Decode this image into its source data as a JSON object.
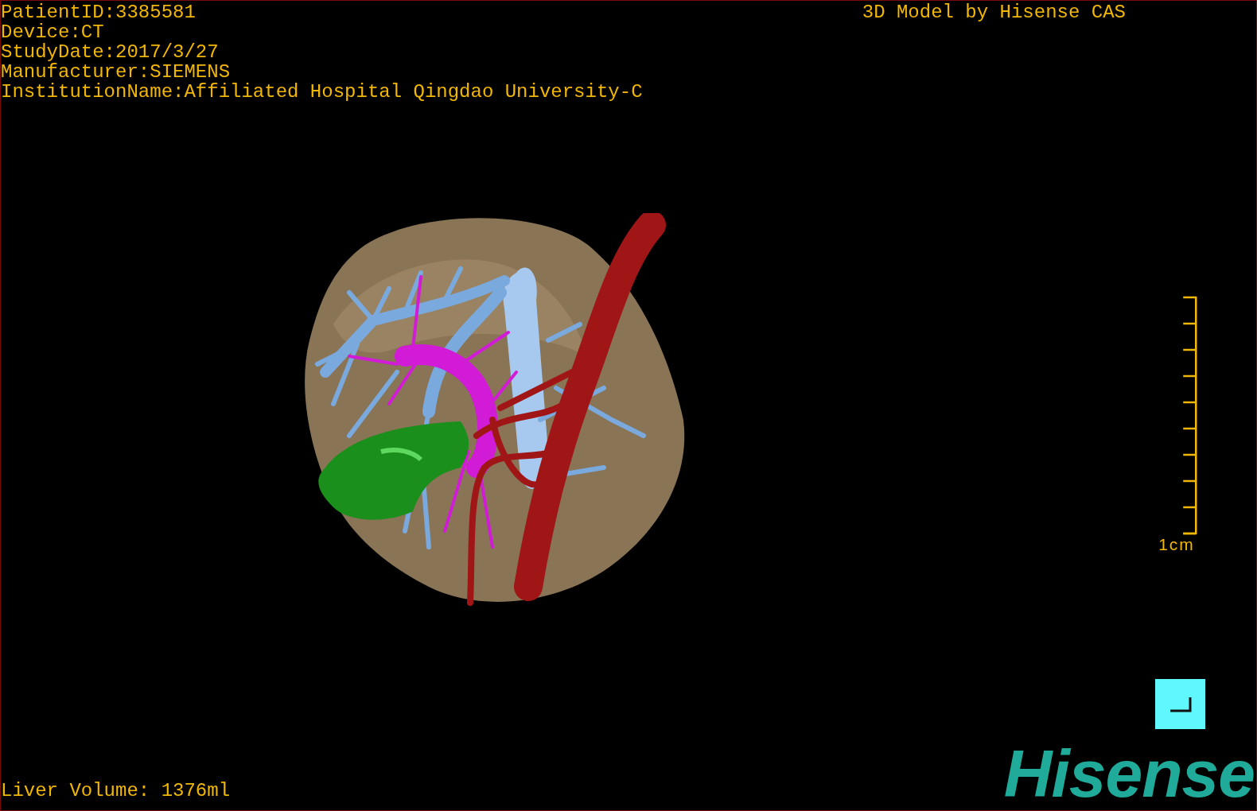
{
  "info_lines": [
    "PatientID:3385581",
    "Device:CT",
    "StudyDate:2017/3/27",
    "Manufacturer:SIEMENS",
    "InstitutionName:Affiliated Hospital Qingdao University-C"
  ],
  "credit": "3D Model by Hisense CAS",
  "scale_bar": {
    "label": "1cm"
  },
  "liver_volume": "Liver Volume: 1376ml",
  "logo": "Hisense"
}
